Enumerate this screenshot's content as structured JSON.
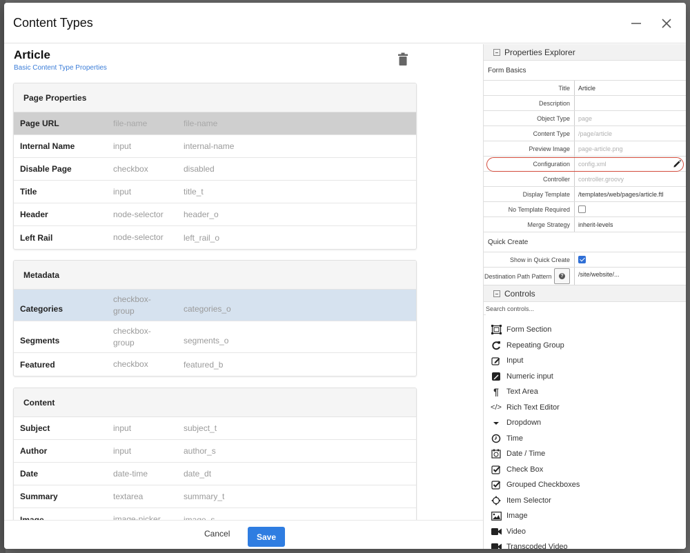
{
  "dialog": {
    "title": "Content Types",
    "minimize_label": "minimize",
    "close_label": "close"
  },
  "content_type": {
    "name": "Article",
    "subtitle": "Basic Content Type Properties"
  },
  "sections": [
    {
      "title": "Page Properties",
      "rows": [
        {
          "name": "Page URL",
          "type": "file-name",
          "id": "file-name",
          "state": "selected"
        },
        {
          "name": "Internal Name",
          "type": "input",
          "id": "internal-name"
        },
        {
          "name": "Disable Page",
          "type": "checkbox",
          "id": "disabled"
        },
        {
          "name": "Title",
          "type": "input",
          "id": "title_t"
        },
        {
          "name": "Header",
          "type": "node-selector",
          "id": "header_o"
        },
        {
          "name": "Left Rail",
          "type": "node-selector",
          "id": "left_rail_o"
        }
      ]
    },
    {
      "title": "Metadata",
      "rows": [
        {
          "name": "Categories",
          "type": "checkbox-group",
          "id": "categories_o",
          "state": "hover"
        },
        {
          "name": "Segments",
          "type": "checkbox-group",
          "id": "segments_o"
        },
        {
          "name": "Featured",
          "type": "checkbox",
          "id": "featured_b"
        }
      ]
    },
    {
      "title": "Content",
      "rows": [
        {
          "name": "Subject",
          "type": "input",
          "id": "subject_t"
        },
        {
          "name": "Author",
          "type": "input",
          "id": "author_s"
        },
        {
          "name": "Date",
          "type": "date-time",
          "id": "date_dt"
        },
        {
          "name": "Summary",
          "type": "textarea",
          "id": "summary_t"
        },
        {
          "name": "Image",
          "type": "image-picker",
          "id": "image_s"
        }
      ]
    }
  ],
  "footer": {
    "cancel_label": "Cancel",
    "save_label": "Save"
  },
  "properties_explorer": {
    "title": "Properties Explorer",
    "form_basics_label": "Form Basics",
    "form_basics": [
      {
        "label": "Title",
        "value": "Article",
        "muted": false
      },
      {
        "label": "Description",
        "value": "",
        "muted": false
      },
      {
        "label": "Object Type",
        "value": "page",
        "muted": true
      },
      {
        "label": "Content Type",
        "value": "/page/article",
        "muted": true
      },
      {
        "label": "Preview Image",
        "value": "page-article.png",
        "muted": true
      },
      {
        "label": "Configuration",
        "value": "config.xml",
        "muted": true,
        "highlighted": true
      },
      {
        "label": "Controller",
        "value": "controller.groovy",
        "muted": true
      },
      {
        "label": "Display Template",
        "value": "/templates/web/pages/article.ftl",
        "muted": false
      },
      {
        "label": "No Template Required",
        "checked": false
      },
      {
        "label": "Merge Strategy",
        "value": "inherit-levels",
        "muted": false
      }
    ],
    "quick_create_label": "Quick Create",
    "show_in_quick_create": {
      "label": "Show in Quick Create",
      "checked": true
    },
    "destination_path": {
      "label": "Destination Path Pattern",
      "value": "/site/website/..."
    }
  },
  "controls": {
    "title": "Controls",
    "search_placeholder": "Search controls...",
    "items": [
      {
        "label": "Form Section",
        "icon": "form-section-icon"
      },
      {
        "label": "Repeating Group",
        "icon": "repeat-icon"
      },
      {
        "label": "Input",
        "icon": "edit-icon"
      },
      {
        "label": "Numeric input",
        "icon": "numeric-edit-icon"
      },
      {
        "label": "Text Area",
        "icon": "paragraph-icon"
      },
      {
        "label": "Rich Text Editor",
        "icon": "code-icon"
      },
      {
        "label": "Dropdown",
        "icon": "caret-down-icon"
      },
      {
        "label": "Time",
        "icon": "clock-icon"
      },
      {
        "label": "Date / Time",
        "icon": "calendar-clock-icon"
      },
      {
        "label": "Check Box",
        "icon": "checkbox-icon"
      },
      {
        "label": "Grouped Checkboxes",
        "icon": "checkbox-group-icon"
      },
      {
        "label": "Item Selector",
        "icon": "crosshair-icon"
      },
      {
        "label": "Image",
        "icon": "image-icon"
      },
      {
        "label": "Video",
        "icon": "video-icon"
      },
      {
        "label": "Transcoded Video",
        "icon": "video-icon"
      }
    ]
  }
}
